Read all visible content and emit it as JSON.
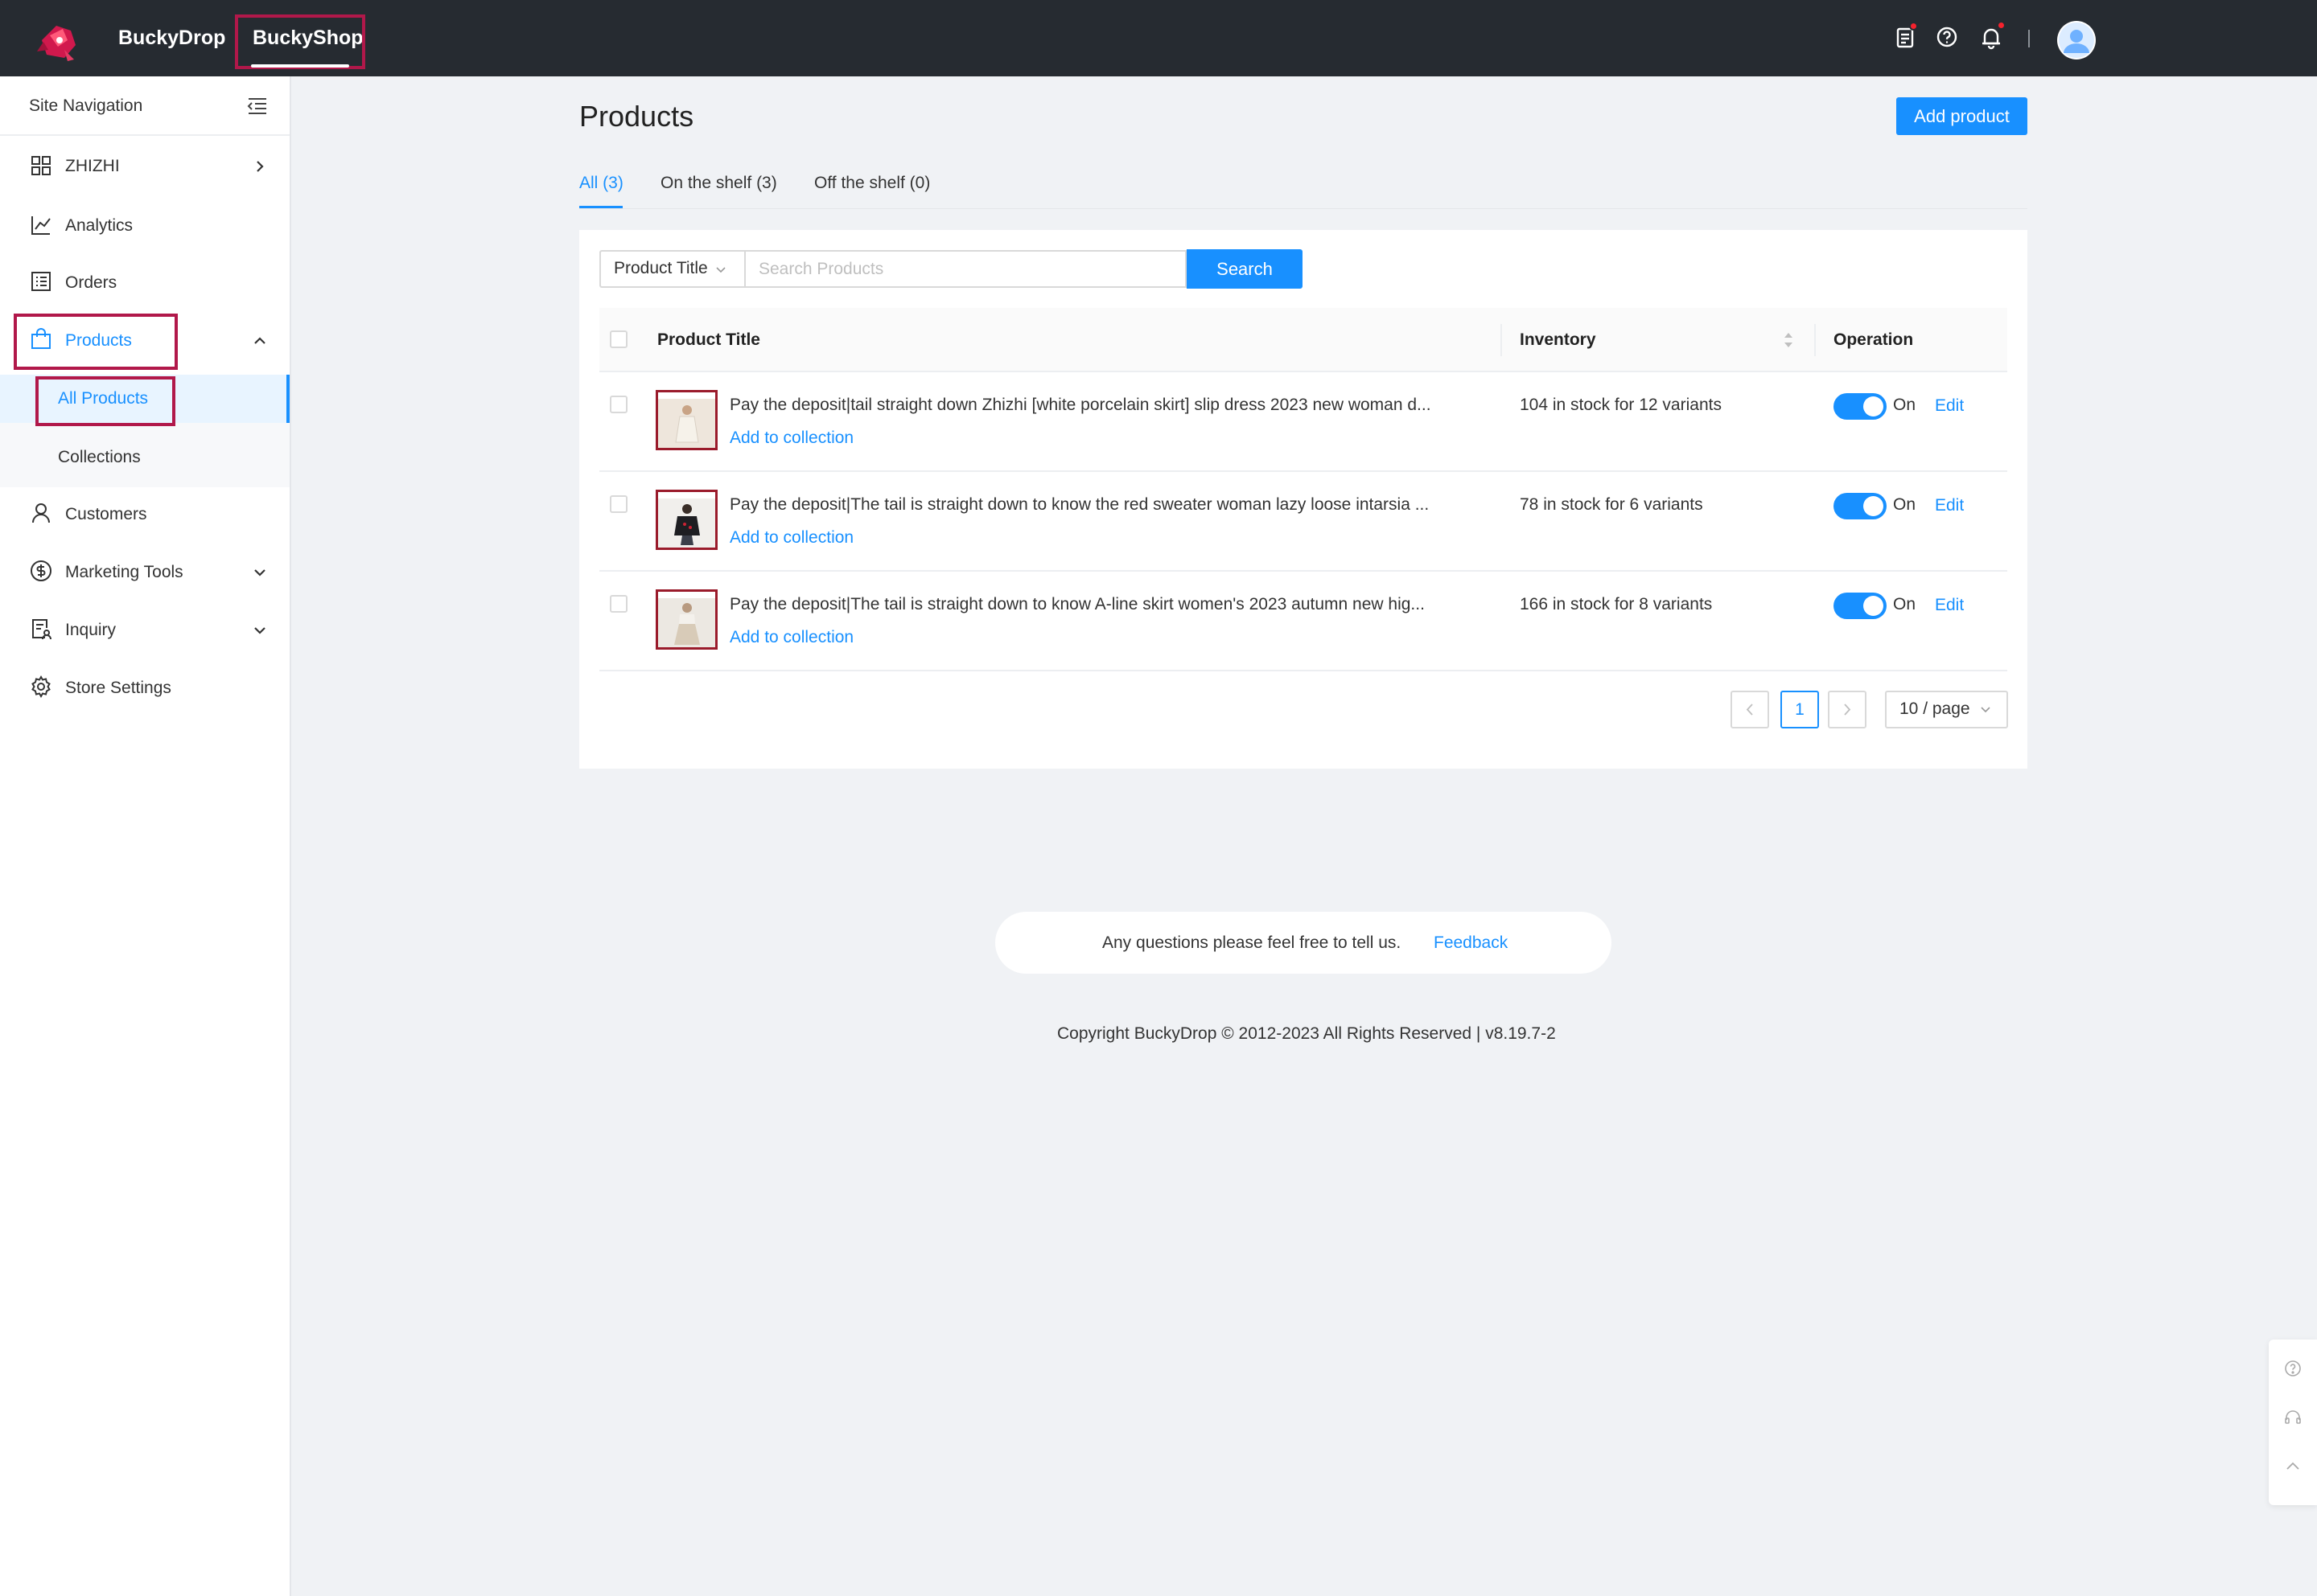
{
  "header": {
    "brand_primary": "BuckyDrop",
    "brand_secondary": "BuckyShop",
    "icons": [
      "orders-icon",
      "help-icon",
      "bell-icon",
      "avatar"
    ]
  },
  "sidebar": {
    "title": "Site Navigation",
    "items": [
      {
        "label": "ZHIZHI",
        "icon": "grid-icon"
      },
      {
        "label": "Analytics",
        "icon": "chart-icon"
      },
      {
        "label": "Orders",
        "icon": "list-icon"
      },
      {
        "label": "Products",
        "icon": "bag-icon"
      },
      {
        "label": "Customers",
        "icon": "user-icon"
      },
      {
        "label": "Marketing Tools",
        "icon": "dollar-icon"
      },
      {
        "label": "Inquiry",
        "icon": "inquiry-icon"
      },
      {
        "label": "Store Settings",
        "icon": "gear-icon"
      }
    ],
    "sub_items": [
      {
        "label": "All Products"
      },
      {
        "label": "Collections"
      }
    ]
  },
  "main": {
    "title": "Products",
    "add_button": "Add product",
    "tabs": [
      {
        "label": "All (3)"
      },
      {
        "label": "On the shelf (3)"
      },
      {
        "label": "Off the shelf (0)"
      }
    ],
    "search": {
      "field_select": "Product Title",
      "placeholder": "Search Products",
      "button": "Search"
    },
    "table": {
      "columns": [
        "Product Title",
        "Inventory",
        "Operation"
      ],
      "rows": [
        {
          "title": "Pay the deposit|tail straight down Zhizhi [white porcelain skirt] slip dress 2023 new woman d...",
          "action_link": "Add to collection",
          "inventory": "104 in stock for 12 variants",
          "status": "On",
          "edit": "Edit"
        },
        {
          "title": "Pay the deposit|The tail is straight down to know the red sweater woman lazy loose intarsia ...",
          "action_link": "Add to collection",
          "inventory": "78 in stock for 6 variants",
          "status": "On",
          "edit": "Edit"
        },
        {
          "title": "Pay the deposit|The tail is straight down to know A-line skirt women's 2023 autumn new hig...",
          "action_link": "Add to collection",
          "inventory": "166 in stock for 8 variants",
          "status": "On",
          "edit": "Edit"
        }
      ]
    },
    "pagination": {
      "current_page": "1",
      "page_size": "10 / page"
    }
  },
  "footer": {
    "feedback_text": "Any questions please feel free to tell us.",
    "feedback_link": "Feedback",
    "copyright": "Copyright BuckyDrop © 2012-2023 All Rights Reserved | v8.19.7-2"
  },
  "colors": {
    "accent": "#1890ff",
    "header_bg": "#262b31",
    "highlight_border": "#b1184a"
  }
}
